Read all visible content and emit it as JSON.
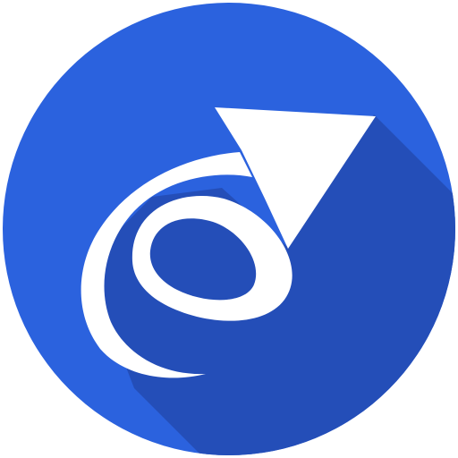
{
  "app_icon": {
    "name": "spiral-arrow-icon",
    "background_color": "#2B62DE",
    "shadow_color": "#244EB8",
    "foreground_color": "#FFFFFF"
  }
}
